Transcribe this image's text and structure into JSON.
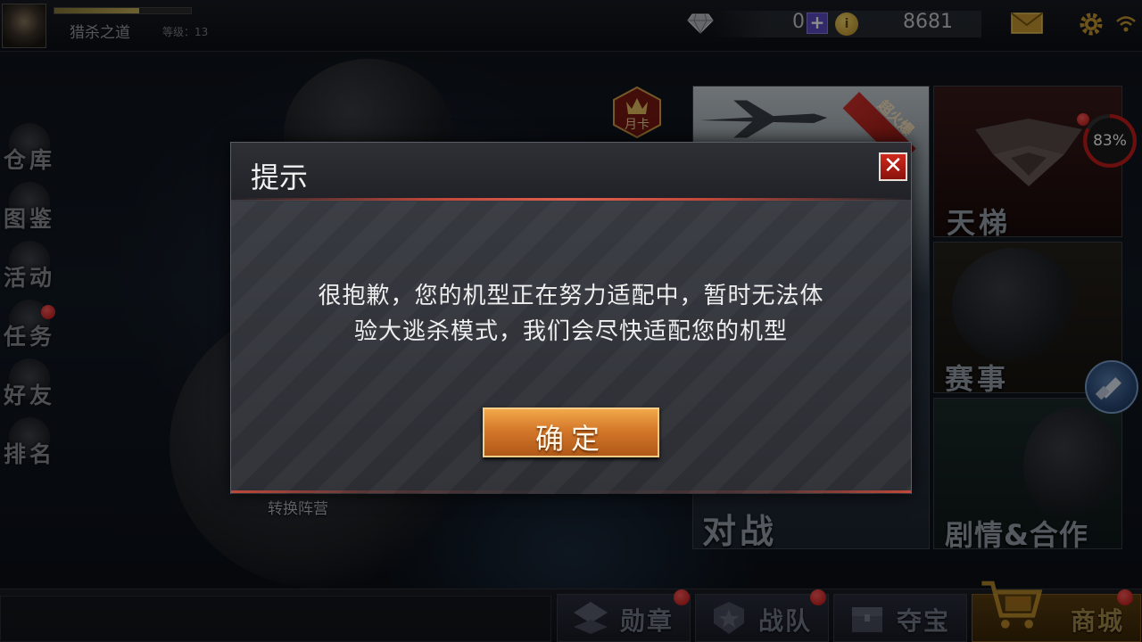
{
  "player": {
    "name": "猎杀之道",
    "level_label": "等级：13",
    "xp_progress": 0.62
  },
  "currency": {
    "diamonds": "0",
    "coin_icon_glyph": "i",
    "add_glyph": "+",
    "gold": "8681"
  },
  "side_menu": [
    {
      "label": "仓库",
      "icon": "warehouse-icon"
    },
    {
      "label": "图鉴",
      "icon": "codex-icon"
    },
    {
      "label": "活动",
      "icon": "event-icon"
    },
    {
      "label": "任务",
      "icon": "mission-icon"
    },
    {
      "label": "好友",
      "icon": "friends-icon"
    },
    {
      "label": "排名",
      "icon": "ranking-icon"
    }
  ],
  "tiles": {
    "ladder": "天梯",
    "match": "赛事",
    "story": "剧情&合作",
    "battle": "对战",
    "battle_badge": "超火爆"
  },
  "progress_ring": {
    "label": "83%",
    "value": 0.83
  },
  "month_card": "月卡",
  "switch_camp": "转换阵营",
  "bottom_nav": [
    {
      "label": "勋章",
      "icon": "medal-icon"
    },
    {
      "label": "战队",
      "icon": "team-icon"
    },
    {
      "label": "夺宝",
      "icon": "treasure-icon"
    },
    {
      "label": "商城",
      "icon": "shop-cart-icon"
    }
  ],
  "dialog": {
    "title": "提示",
    "close_glyph": "✕",
    "message_line1": "很抱歉，您的机型正在努力适配中，暂时无法体",
    "message_line2": "验大逃杀模式，我们会尽快适配您的机型",
    "confirm_label": "确定"
  },
  "colors": {
    "accent_red": "#c0483a",
    "confirm_orange": "#d4782a",
    "badge_red": "#e02020"
  }
}
